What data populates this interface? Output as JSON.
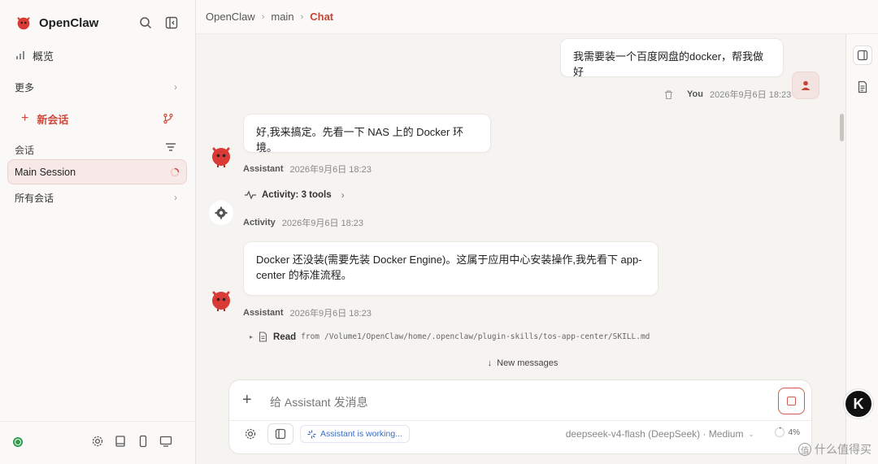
{
  "app": {
    "name": "OpenClaw"
  },
  "sidebar": {
    "overview_label": "概览",
    "more_label": "更多",
    "new_chat_label": "新会话",
    "sessions_section": "会话",
    "active_session": "Main Session",
    "all_sessions_label": "所有会话"
  },
  "breadcrumb": {
    "root": "OpenClaw",
    "branch": "main",
    "current": "Chat"
  },
  "messages": {
    "user_text": "我需要装一个百度网盘的docker，帮我做好",
    "user_name": "You",
    "user_time": "2026年9月6日 18:23",
    "a1_text": "好,我来搞定。先看一下 NAS 上的 Docker 环境。",
    "a1_name": "Assistant",
    "a1_time": "2026年9月6日 18:23",
    "activity_label": "Activity: 3 tools",
    "activity_name": "Activity",
    "activity_time": "2026年9月6日 18:23",
    "a2_text_line1": "Docker 还没装(需要先装 Docker Engine)。这属于应用中心安装操作,我先看下 app-",
    "a2_text_line2": "center 的标准流程。",
    "a2_name": "Assistant",
    "a2_time": "2026年9月6日 18:23",
    "read_label": "Read",
    "read_from": "from",
    "read_path": "/Volume1/OpenClaw/home/.openclaw/plugin-skills/tos-app-center/SKILL.md",
    "new_messages_label": "New messages"
  },
  "composer": {
    "placeholder": "给 Assistant 发消息",
    "working_label": "Assistant is working...",
    "model_label": "deepseek-v4-flash (DeepSeek) · Medium",
    "context_percent": "4%"
  },
  "overlay": {
    "badge_letter": "K",
    "watermark": "什么值得买"
  },
  "colors": {
    "accent": "#c44536",
    "status_ok": "#2e9e4e",
    "working_blue": "#3a6cc4"
  }
}
